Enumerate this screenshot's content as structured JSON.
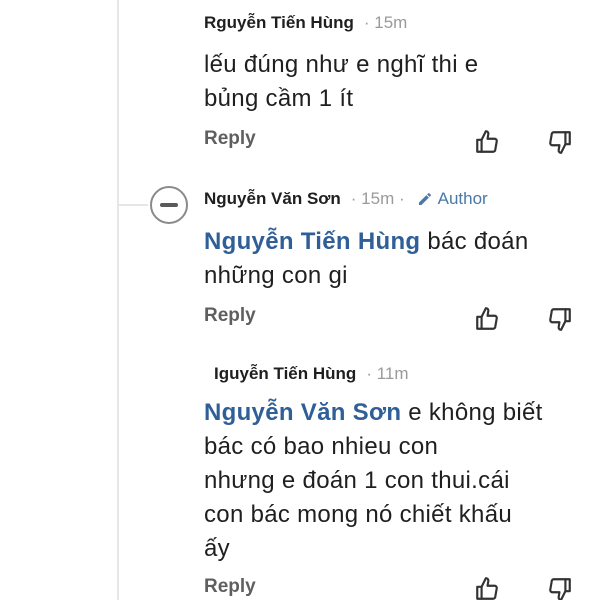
{
  "comments": [
    {
      "author": "Rguyễn Tiến Hùng",
      "time": "· 15m",
      "lines": [
        "lếu  đúng  như  e nghĩ  thi   e",
        "bủng  cầm  1 ít"
      ],
      "reply_label": "Reply"
    },
    {
      "author": "Nguyễn Văn Sơn",
      "time": "· 15m ·",
      "badge": "Author",
      "mention": "Nguyễn Tiến Hùng",
      "lines": [
        " bác đoán",
        "những con gi"
      ],
      "reply_label": "Reply"
    },
    {
      "author": "Iguyễn Tiến Hùng",
      "time": "· 11m",
      "mention": "Nguyễn Văn Sơn",
      "lines": [
        " e không  biết",
        "bác  có  bao  nhieu  con",
        "nhưng  e đoán  1 con thui.cái",
        "con bác  mong nó  chiết khấu",
        "ấy"
      ],
      "reply_label": "Reply"
    }
  ],
  "icons": {
    "upvote": "thumbs-up-icon",
    "downvote": "thumbs-down-icon",
    "author_badge": "pencil-icon",
    "avatar": "avatar"
  },
  "colors": {
    "mention": "#2f5f96",
    "author_badge": "#4a78a8",
    "time": "#9a9a9a"
  }
}
